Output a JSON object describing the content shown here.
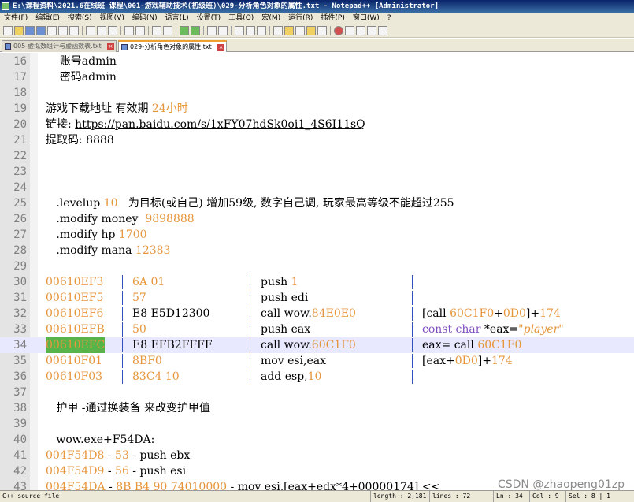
{
  "window": {
    "title": "E:\\课程资料\\2021.6在线班 课程\\001-游戏辅助技术(初级班)\\029-分析角色对象的属性.txt - Notepad++ [Administrator]"
  },
  "menu": [
    "文件(F)",
    "编辑(E)",
    "搜索(S)",
    "视图(V)",
    "编码(N)",
    "语言(L)",
    "设置(T)",
    "工具(O)",
    "宏(M)",
    "运行(R)",
    "插件(P)",
    "窗口(W)",
    "?"
  ],
  "tabs": [
    {
      "label": "005-虚拟数组计与虚函数表.txt",
      "active": false
    },
    {
      "label": "029-分析角色对象的属性.txt",
      "active": true
    }
  ],
  "editor": {
    "lines": [
      {
        "n": "16",
        "text": "    账号admin"
      },
      {
        "n": "17",
        "text": "    密码admin"
      },
      {
        "n": "18",
        "text": ""
      },
      {
        "n": "19",
        "text": "游戏下载地址 有效期 ",
        "orange": "24小时"
      },
      {
        "n": "20",
        "text": "链接: ",
        "link": "https://pan.baidu.com/s/1xFY07hdSk0oi1_4S6I11sQ"
      },
      {
        "n": "21",
        "text": "提取码: 8888"
      },
      {
        "n": "22",
        "text": ""
      },
      {
        "n": "23",
        "text": ""
      },
      {
        "n": "24",
        "text": ""
      },
      {
        "n": "25",
        "text": "   .levelup ",
        "orange": "10",
        "rest": "   为目标(或自己) 增加59级, 数字自己调, 玩家最高等级不能超过255"
      },
      {
        "n": "26",
        "text": "   .modify money  ",
        "orange": "9898888"
      },
      {
        "n": "27",
        "text": "   .modify hp ",
        "orange": "1700"
      },
      {
        "n": "28",
        "text": "   .modify mana ",
        "orange": "12383"
      },
      {
        "n": "29",
        "text": ""
      },
      {
        "n": "37",
        "text": ""
      },
      {
        "n": "38",
        "text": "   护甲 -通过换装备 来改变护甲值"
      },
      {
        "n": "39",
        "text": ""
      },
      {
        "n": "40",
        "text": "   wow.exe+F54DA:"
      },
      {
        "n": "41",
        "text": ""
      },
      {
        "n": "42",
        "text": ""
      },
      {
        "n": "43",
        "text": ""
      }
    ],
    "asm_rows": [
      {
        "n": "30",
        "addr": "00610EF3",
        "bytes": "6A 01",
        "op": "push ",
        "arg": "1",
        "comment": ""
      },
      {
        "n": "31",
        "addr": "00610EF5",
        "bytes": "57",
        "op": "push edi",
        "arg": "",
        "comment": ""
      },
      {
        "n": "32",
        "addr": "00610EF6",
        "bytes": "E8 E5D12300",
        "op": "call wow.",
        "arg": "84E0E0",
        "comment": "[call 60C1F0+0D0]+174"
      },
      {
        "n": "33",
        "addr": "00610EFB",
        "bytes": "50",
        "op": "push eax",
        "arg": "",
        "comment": "const char *eax=\"player\""
      },
      {
        "n": "34",
        "addr": "00610EFC",
        "bytes": "E8 EFB2FFFF",
        "op": "call wow.",
        "arg": "60C1F0",
        "comment": "eax= call 60C1F0"
      },
      {
        "n": "35",
        "addr": "00610F01",
        "bytes": "8BF0",
        "op": "mov esi,eax",
        "arg": "",
        "comment": "[eax+0D0]+174"
      },
      {
        "n": "36",
        "addr": "00610F03",
        "bytes": "83C4 10",
        "op": "add esp,",
        "arg": "10",
        "comment": ""
      }
    ],
    "tail": [
      {
        "n": "41",
        "addr": "004F54D8",
        "rest": " - ",
        "num": "53",
        "ins": " - push ebx"
      },
      {
        "n": "42",
        "addr": "004F54D9",
        "rest": " - ",
        "num": "56",
        "ins": " - push esi"
      },
      {
        "n": "43",
        "addr": "004F54DA",
        "rest": " - ",
        "num": "8B B4 90 74010000",
        "ins": " - mov esi,[eax+edx*4+00000174] <<"
      }
    ]
  },
  "status": {
    "lang": "C++ source file",
    "length": "length : 2,181",
    "lines": "lines : 72",
    "ln": "Ln : 34",
    "col": "Col : 9",
    "sel": "Sel : 8 | 1"
  },
  "watermark": "CSDN @zhaopeng01zp",
  "colors": {
    "number": "#e6963c",
    "current_line": "#e8e8ff",
    "addr_highlight": "#58b44a"
  }
}
